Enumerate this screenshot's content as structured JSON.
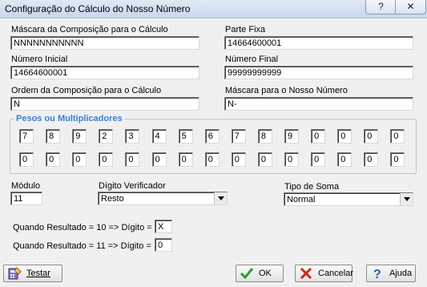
{
  "window": {
    "title": "Configuração do Cálculo do Nosso Número",
    "help_glyph": "?",
    "close_glyph": "✕"
  },
  "mascara_composicao": {
    "label": "Máscara da Composição para o Cálculo",
    "value": "NNNNNNNNNNN"
  },
  "parte_fixa": {
    "label": "Parte Fixa",
    "value": "14664600001"
  },
  "numero_inicial": {
    "label": "Número Inicial",
    "value": "14664600001"
  },
  "numero_final": {
    "label": "Número Final",
    "value": "99999999999"
  },
  "ordem_composicao": {
    "label": "Ordem da Composição para o Cálculo",
    "value": "N"
  },
  "mascara_nosso_numero": {
    "label": "Máscara para o Nosso Número",
    "value": "N-"
  },
  "pesos": {
    "title": "Pesos ou Multiplicadores",
    "row1": [
      "7",
      "8",
      "9",
      "2",
      "3",
      "4",
      "5",
      "6",
      "7",
      "8",
      "9",
      "0",
      "0",
      "0",
      "0"
    ],
    "row2": [
      "0",
      "0",
      "0",
      "0",
      "0",
      "0",
      "0",
      "0",
      "0",
      "0",
      "0",
      "0",
      "0",
      "0",
      "0"
    ]
  },
  "modulo": {
    "label": "Módulo",
    "value": "11"
  },
  "digito_verificador": {
    "label": "Dígito Verificador",
    "value": "Resto"
  },
  "tipo_soma": {
    "label": "Tipo de Soma",
    "value": "Normal"
  },
  "resultado10": {
    "label": "Quando Resultado = 10 => Dígito =",
    "value": "X"
  },
  "resultado11": {
    "label": "Quando Resultado = 11 => Dígito =",
    "value": "0"
  },
  "buttons": {
    "testar": "Testar",
    "ok": "OK",
    "cancelar": "Cancelar",
    "ajuda": "Ajuda"
  },
  "colors": {
    "groupbox_title": "#3a7fd0",
    "ok_check": "#2e9a2e",
    "cancel_x": "#c8281e",
    "help_q": "#1f5fb0"
  }
}
